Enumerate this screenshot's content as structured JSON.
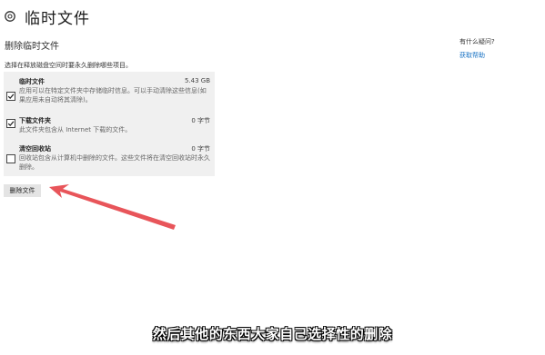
{
  "header": {
    "icon": "gear-icon",
    "title": "临时文件"
  },
  "section_title": "删除临时文件",
  "description": "选择在释放磁盘空间时要永久删除哪些项目。",
  "items": [
    {
      "name": "临时文件",
      "size": "5.43 GB",
      "checked": true,
      "desc": "应用可以在特定文件夹中存储临时信息。可以手动清除这些信息(如果应用未自动将其清除)。"
    },
    {
      "name": "下载文件夹",
      "size": "0 字节",
      "checked": true,
      "desc": "此文件夹包含从 Internet 下载的文件。"
    },
    {
      "name": "清空回收站",
      "size": "0 字节",
      "checked": false,
      "desc": "回收站包含从计算机中删除的文件。这些文件将在清空回收站时永久删除。"
    }
  ],
  "delete_button": "删除文件",
  "help": {
    "question": "有什么疑问?",
    "link": "获取帮助"
  },
  "subtitle": "然后其他的东西大家自己选择性的删除",
  "colors": {
    "panel_bg": "#f0f0f0",
    "link": "#1a73c4",
    "arrow": "#e8555a"
  }
}
